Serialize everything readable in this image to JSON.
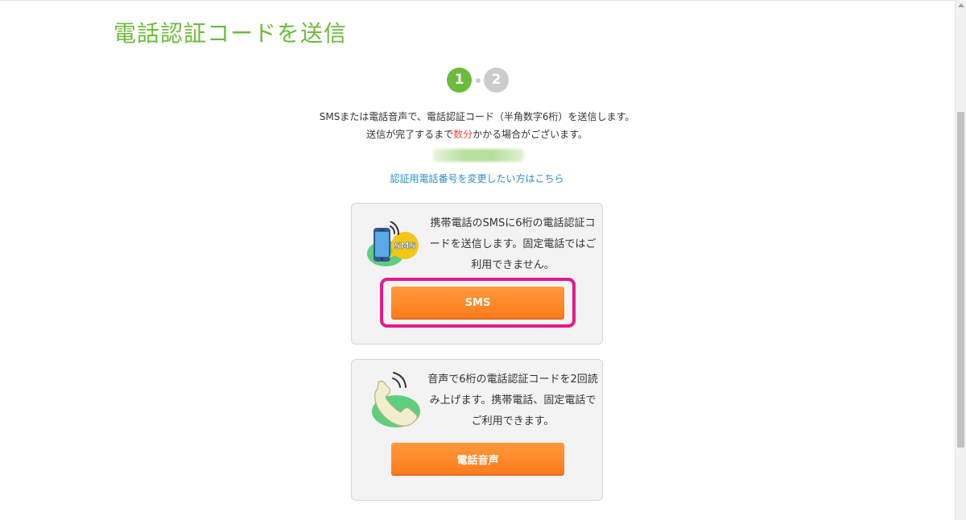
{
  "page": {
    "title": "電話認証コードを送信"
  },
  "stepper": {
    "steps": [
      "1",
      "2"
    ],
    "current_step": 1
  },
  "intro": {
    "line1": "SMSまたは電話音声で、電話認証コード（半角数字6桁）を送信します。",
    "line2_before": "送信が完了するまで",
    "line2_highlight": "数分",
    "line2_after": "かかる場合がございます。"
  },
  "change_link": "認証用電話番号を変更したい方はこちら",
  "sms_card": {
    "icon": "phone-sms-icon",
    "icon_badge": "SMS",
    "description": "携帯電話のSMSに6桁の電話認証コードを送信します。固定電話ではご利用できません。",
    "button_label": "SMS"
  },
  "voice_card": {
    "icon": "phone-handset-icon",
    "description": "音声で6桁の電話認証コードを2回読み上げます。携帯電話、固定電話でご利用できます。",
    "button_label": "電話音声"
  },
  "colors": {
    "brand_green": "#6cbb3c",
    "button_orange": "#ff8a2a",
    "link_blue": "#2a8fc9",
    "highlight_magenta": "#e8198b",
    "accent_red": "#e94b3c"
  }
}
